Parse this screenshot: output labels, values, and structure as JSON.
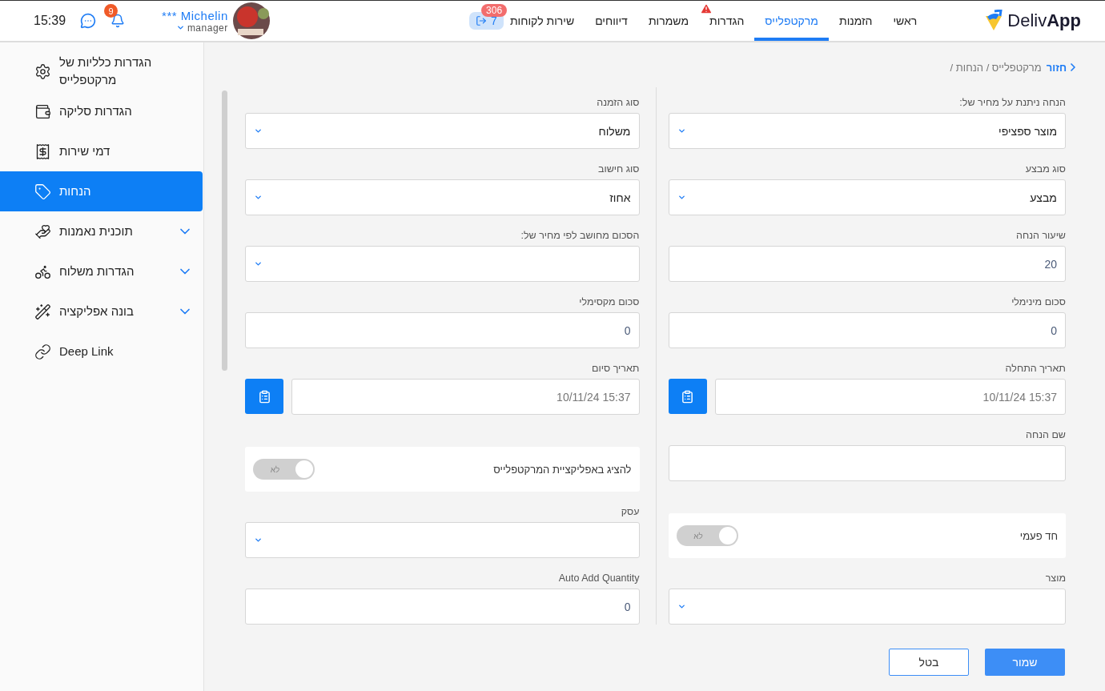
{
  "header": {
    "logo": "Deliv**App**",
    "nav": [
      {
        "label": "ראשי",
        "selected": false,
        "alert": false
      },
      {
        "label": "הזמנות",
        "selected": false,
        "alert": false
      },
      {
        "label": "מרקטפלייס",
        "selected": true,
        "alert": false
      },
      {
        "label": "הגדרות",
        "selected": false,
        "alert": true
      },
      {
        "label": "משמרות",
        "selected": false,
        "alert": false
      },
      {
        "label": "דיווחים",
        "selected": false,
        "alert": false
      },
      {
        "label": "שירות לקוחות",
        "selected": false,
        "alert": false,
        "chip": "7",
        "badge": "306"
      }
    ],
    "user": {
      "name": "*** Michelin",
      "role": "manager"
    },
    "notifications": "9",
    "time": "15:39"
  },
  "sidebar": {
    "items": [
      {
        "label": "הגדרות כלליות של מרקטפלייס",
        "kind": "link",
        "selected": false
      },
      {
        "label": "הגדרות סליקה",
        "kind": "link",
        "selected": false
      },
      {
        "label": "דמי שירות",
        "kind": "link",
        "selected": false
      },
      {
        "label": "הנחות",
        "kind": "link",
        "selected": true
      },
      {
        "label": "תוכנית נאמנות",
        "kind": "group",
        "selected": false
      },
      {
        "label": "הגדרות משלוח",
        "kind": "group",
        "selected": false
      },
      {
        "label": "בונה אפליקציה",
        "kind": "group",
        "selected": false
      },
      {
        "label": "Deep Link",
        "kind": "link",
        "selected": false
      }
    ]
  },
  "breadcrumb": {
    "back": "חזור",
    "path": "מרקטפלייס / הנחות /"
  },
  "form": {
    "columns": [
      {
        "fields": [
          {
            "kind": "select",
            "label": "הנחה ניתנת על מחיר של:",
            "value": "מוצר ספציפי"
          },
          {
            "kind": "select",
            "label": "סוג מבצע",
            "value": "מבצע"
          },
          {
            "kind": "input",
            "label": "שיעור הנחה",
            "value": "20"
          },
          {
            "kind": "input",
            "label": "סכום מינימלי",
            "value": "0"
          },
          {
            "kind": "date",
            "label": "תאריך התחלה",
            "value": "10/11/24 15:37"
          },
          {
            "kind": "input",
            "label": "שם הנחה"
          },
          {
            "kind": "toggle",
            "label": "חד פעמי",
            "on": false,
            "state_label": "לא"
          },
          {
            "kind": "select",
            "label": "מוצר"
          }
        ]
      },
      {
        "fields": [
          {
            "kind": "select",
            "label": "סוג הזמנה",
            "value": "משלוח"
          },
          {
            "kind": "select",
            "label": "סוג חישוב",
            "value": "אחוז"
          },
          {
            "kind": "select",
            "label": "הסכום מחושב לפי מחיר של:"
          },
          {
            "kind": "input",
            "label": "סכום מקסימלי",
            "value": "0"
          },
          {
            "kind": "date",
            "label": "תאריך סיום",
            "value": "10/11/24 15:37"
          },
          {
            "kind": "toggle",
            "label": "להציג באפליקציית המרקטפלייס",
            "on": false,
            "state_label": "לא"
          },
          {
            "kind": "select",
            "label": "עסק"
          },
          {
            "kind": "input",
            "label": "Auto Add Quantity",
            "value": "0"
          }
        ]
      }
    ]
  },
  "buttons": {
    "save": "שמור",
    "cancel": "בטל"
  }
}
